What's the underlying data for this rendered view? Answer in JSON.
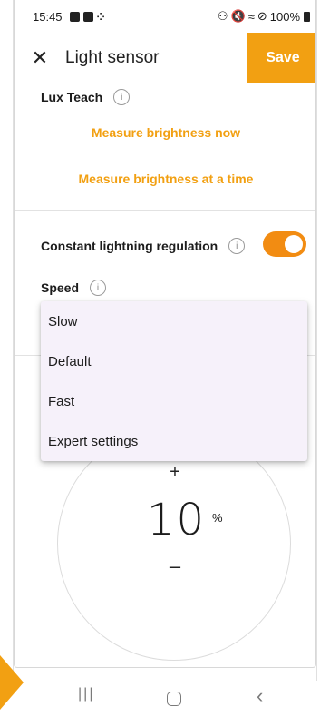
{
  "status_bar": {
    "time": "15:45",
    "battery_text": "100%"
  },
  "app_bar": {
    "title": "Light sensor",
    "save_label": "Save",
    "close_icon": "close-icon"
  },
  "lux_teach": {
    "label": "Lux Teach",
    "measure_now": "Measure brightness now",
    "measure_at_time": "Measure brightness at a time"
  },
  "regulation": {
    "label": "Constant lightning regulation",
    "enabled": true,
    "speed_label": "Speed"
  },
  "speed_dropdown": {
    "options": [
      "Slow",
      "Default",
      "Fast",
      "Expert settings"
    ]
  },
  "dial": {
    "plus": "+",
    "value": "10",
    "unit": "%",
    "minus": "–"
  },
  "colors": {
    "accent": "#f2a012",
    "toggle_on": "#f28c12",
    "dropdown_bg": "#f6f1fa"
  }
}
